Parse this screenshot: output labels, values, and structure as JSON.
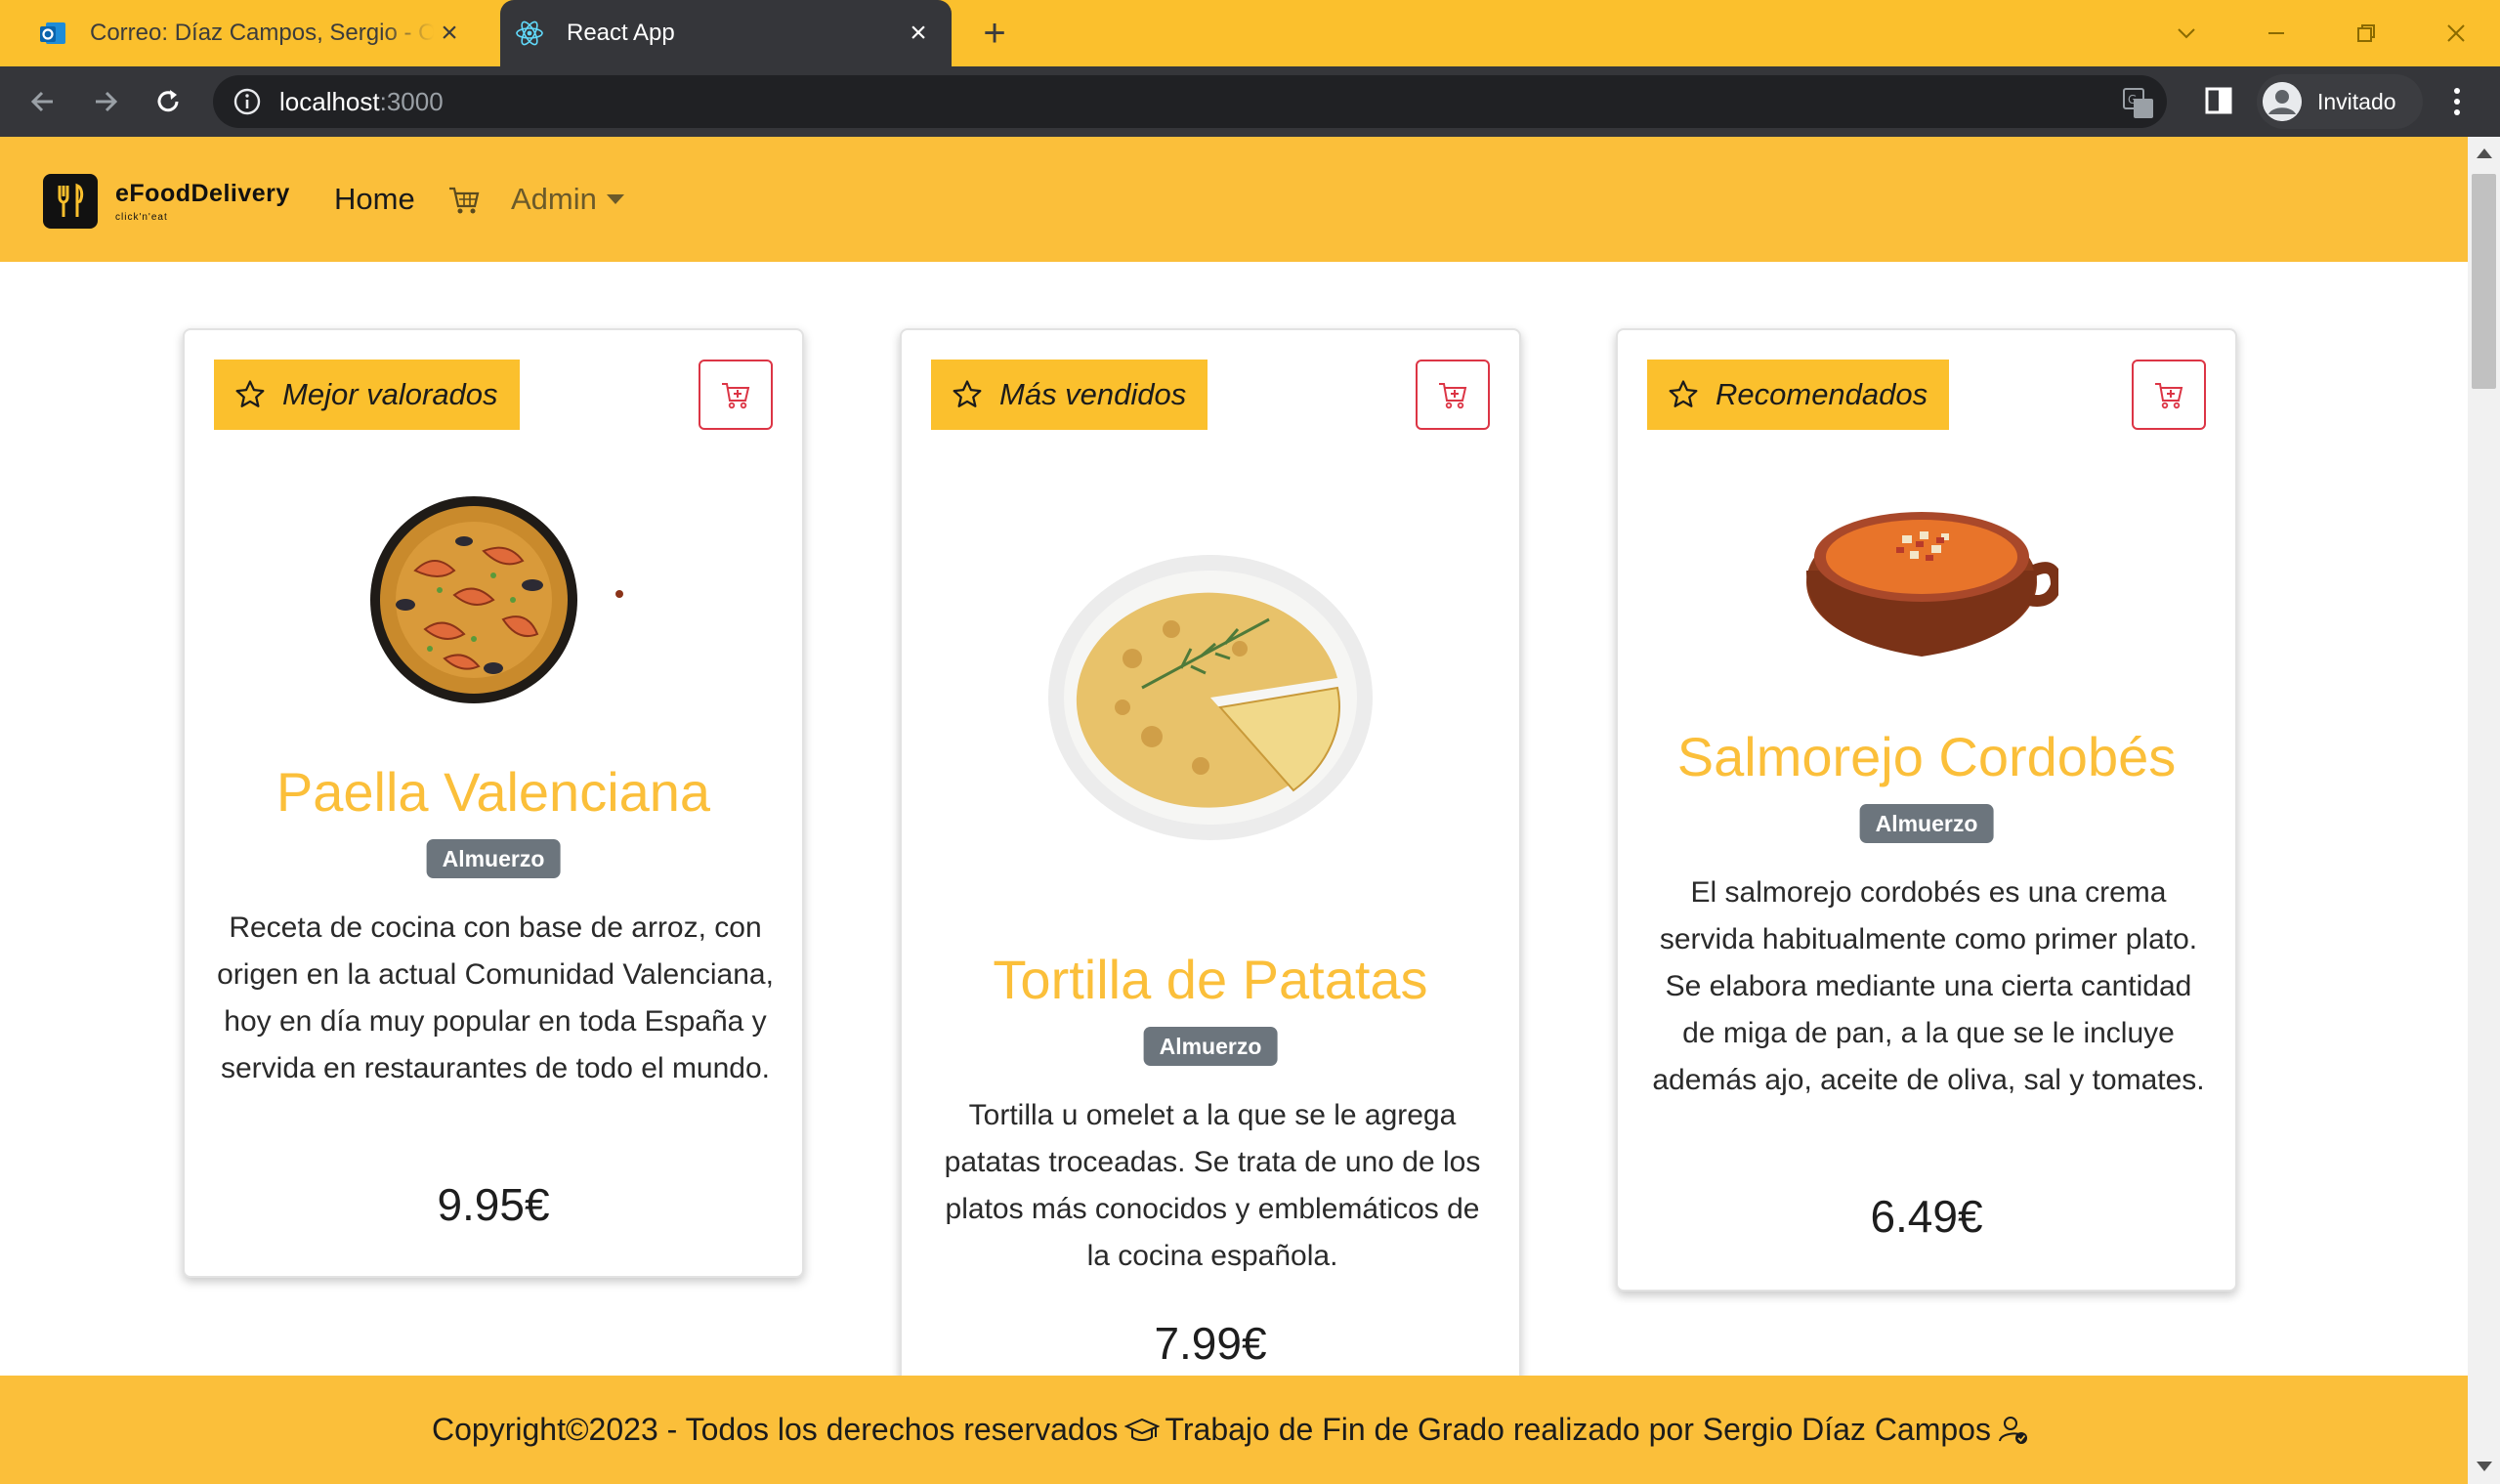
{
  "browser": {
    "tabs": [
      {
        "title": "Correo: Díaz Campos, Sergio - Outlook",
        "favicon": "outlook-icon",
        "active": false
      },
      {
        "title": "React App",
        "favicon": "react-icon",
        "active": true
      }
    ],
    "url_host": "localhost",
    "url_port": ":3000",
    "profile_label": "Invitado"
  },
  "site": {
    "brand_name": "eFoodDelivery",
    "brand_slogan": "click'n'eat",
    "nav_home": "Home",
    "nav_admin": "Admin"
  },
  "cards": [
    {
      "category": "Mejor valorados",
      "name": "Paella Valenciana",
      "meal": "Almuerzo",
      "description": "Receta de cocina con base de arroz, con origen en la actual Comunidad Valenciana, hoy en día muy popular en toda España y servida en restaurantes de todo el mundo.",
      "price": "9.95€",
      "image": "paella-image"
    },
    {
      "category": "Más vendidos",
      "name": "Tortilla de Patatas",
      "meal": "Almuerzo",
      "description": "Tortilla u omelet  a la que se le agrega patatas troceadas. Se trata de uno de los platos más conocidos y emblemáticos de la cocina española.",
      "price": "7.99€",
      "image": "tortilla-image"
    },
    {
      "category": "Recomendados",
      "name": "Salmorejo Cordobés",
      "meal": "Almuerzo",
      "description": "El salmorejo cordobés es una crema servida habitualmente como primer plato. Se elabora mediante una cierta cantidad de miga de pan, a la que se le incluye además ajo, aceite de oliva, sal y tomates.",
      "price": "6.49€",
      "image": "salmorejo-image"
    }
  ],
  "footer": {
    "copyright": "Copyright©2023 - Todos los derechos reservados",
    "credit": "Trabajo de Fin de Grado realizado por Sergio Díaz Campos"
  },
  "colors": {
    "accent": "#fbbf3a",
    "chrome": "#fbc02d",
    "danger": "#dc3545",
    "badge_gray": "#6c757d"
  }
}
